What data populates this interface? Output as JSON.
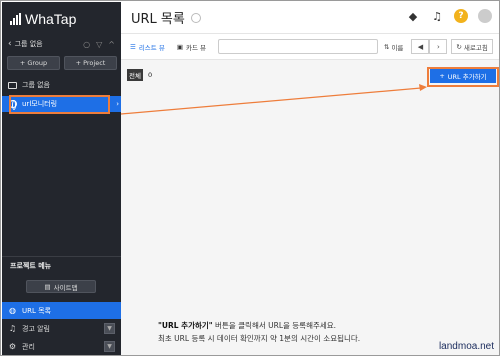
{
  "app": {
    "logo_text": "WhaTap"
  },
  "sidebar": {
    "group_label": "그룹 없음",
    "buttons": [
      {
        "label": "Group"
      },
      {
        "label": "Project"
      }
    ],
    "tree": [
      {
        "label": "그룹 없음",
        "icon": "folder-icon"
      },
      {
        "label": "url모니터링",
        "icon": "globe-icon",
        "active": true
      }
    ],
    "project_menu_title": "프로젝트 메뉴",
    "site_map_label": "사이트맵",
    "menu": [
      {
        "label": "URL 목록",
        "icon": "globe-icon",
        "active": true
      },
      {
        "label": "경고 알림",
        "icon": "bell-icon"
      },
      {
        "label": "관리",
        "icon": "gear-icon"
      }
    ]
  },
  "header": {
    "title": "URL 목록"
  },
  "toolbar": {
    "list_view_label": "리스트 뷰",
    "card_view_label": "카드 뷰",
    "sort_label": "이름",
    "refresh_label": "새로고침"
  },
  "content": {
    "total_label": "전체",
    "total_count": "0",
    "add_button_label": "URL 추가하기",
    "info_highlight": "\"URL 추가하기\"",
    "info_line1_rest": " 버튼을 클릭해서 URL을 등록해주세요.",
    "info_line2": "최초 URL 등록 시 데이터 확인까지 약 1분의 시간이 소요됩니다."
  },
  "watermark": "landmoa.net",
  "colors": {
    "accent": "#1e6fe6",
    "highlight": "#ee7d3b",
    "sidebar_bg": "#23262d"
  }
}
